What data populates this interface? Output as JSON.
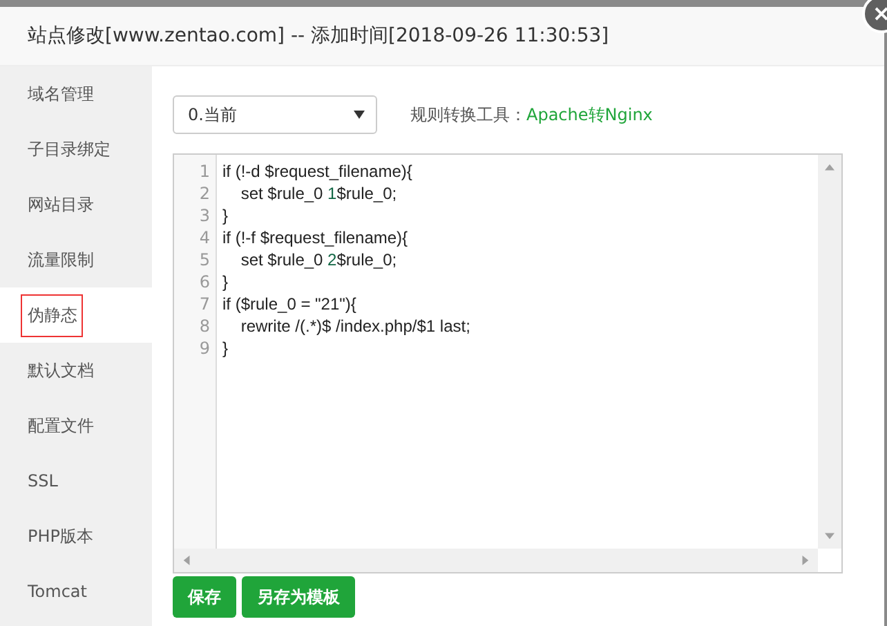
{
  "window": {
    "title": "站点修改[www.zentao.com] -- 添加时间[2018-09-26 11:30:53]"
  },
  "sidebar": {
    "items": [
      {
        "label": "域名管理",
        "selected": false
      },
      {
        "label": "子目录绑定",
        "selected": false
      },
      {
        "label": "网站目录",
        "selected": false
      },
      {
        "label": "流量限制",
        "selected": false
      },
      {
        "label": "伪静态",
        "selected": true
      },
      {
        "label": "默认文档",
        "selected": false
      },
      {
        "label": "配置文件",
        "selected": false
      },
      {
        "label": "SSL",
        "selected": false
      },
      {
        "label": "PHP版本",
        "selected": false
      },
      {
        "label": "Tomcat",
        "selected": false
      }
    ]
  },
  "template_select": {
    "value": "0.当前"
  },
  "converter": {
    "label": "规则转换工具：",
    "link": "Apache转Nginx"
  },
  "editor": {
    "lines": [
      {
        "number": "1",
        "segments": [
          {
            "kind": "plain",
            "text": "if (!-d $request_filename){"
          }
        ]
      },
      {
        "number": "2",
        "segments": [
          {
            "kind": "plain",
            "text": "    set $rule_0 "
          },
          {
            "kind": "number",
            "text": "1"
          },
          {
            "kind": "plain",
            "text": "$rule_0;"
          }
        ]
      },
      {
        "number": "3",
        "segments": [
          {
            "kind": "plain",
            "text": "}"
          }
        ]
      },
      {
        "number": "4",
        "segments": [
          {
            "kind": "plain",
            "text": "if (!-f $request_filename){"
          }
        ]
      },
      {
        "number": "5",
        "segments": [
          {
            "kind": "plain",
            "text": "    set $rule_0 "
          },
          {
            "kind": "number",
            "text": "2"
          },
          {
            "kind": "plain",
            "text": "$rule_0;"
          }
        ]
      },
      {
        "number": "6",
        "segments": [
          {
            "kind": "plain",
            "text": "}"
          }
        ]
      },
      {
        "number": "7",
        "segments": [
          {
            "kind": "plain",
            "text": "if ($rule_0 = \"21\"){"
          }
        ]
      },
      {
        "number": "8",
        "segments": [
          {
            "kind": "plain",
            "text": "    rewrite /(.*)$ /index.php/$1 last;"
          }
        ]
      },
      {
        "number": "9",
        "segments": [
          {
            "kind": "plain",
            "text": "}"
          }
        ]
      }
    ]
  },
  "buttons": [
    "保存",
    "另存为模板"
  ]
}
